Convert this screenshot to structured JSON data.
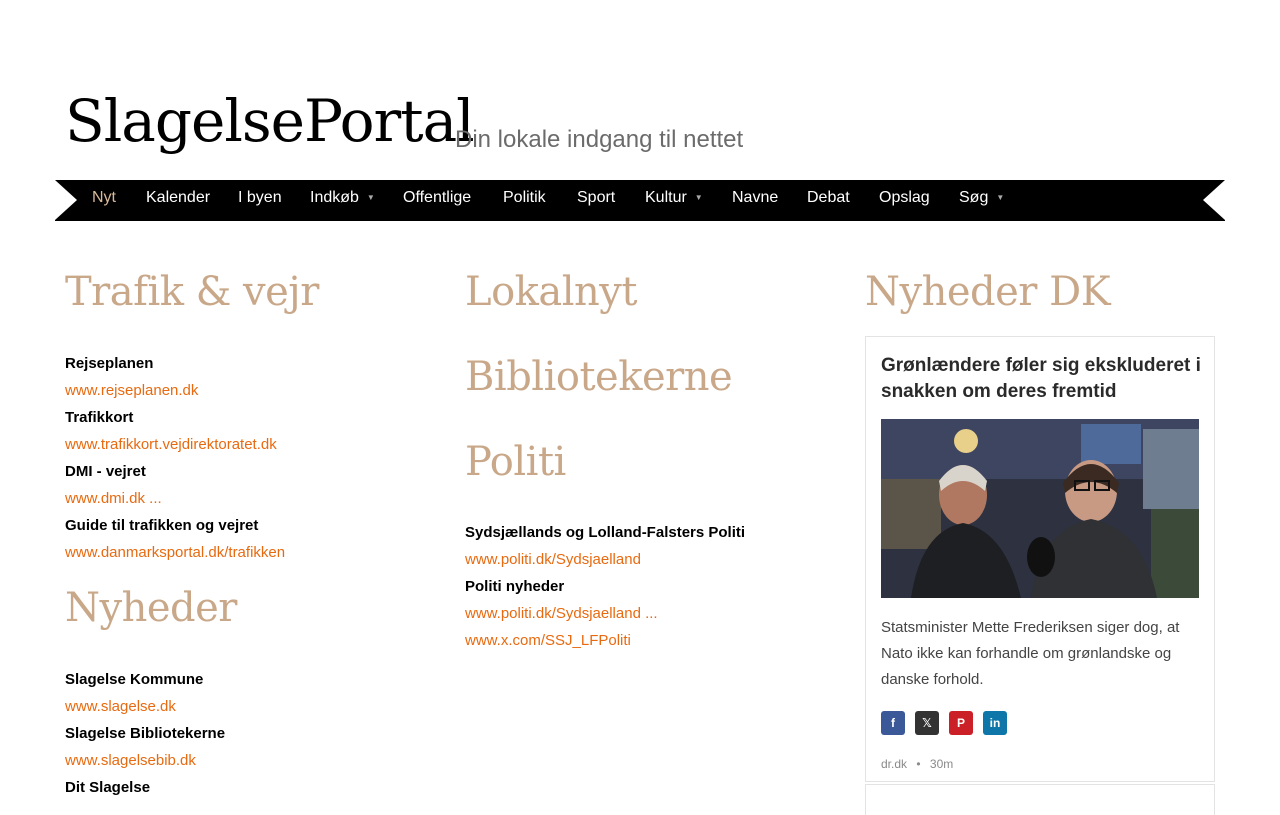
{
  "header": {
    "title": "SlagelsePortal",
    "tagline": "Din lokale indgang til nettet"
  },
  "nav": {
    "items": [
      {
        "label": "Nyt",
        "active": true,
        "dropdown": false
      },
      {
        "label": "Kalender",
        "active": false,
        "dropdown": false
      },
      {
        "label": "I byen",
        "active": false,
        "dropdown": false
      },
      {
        "label": "Indkøb",
        "active": false,
        "dropdown": true
      },
      {
        "label": "Offentlige",
        "active": false,
        "dropdown": false
      },
      {
        "label": "Politik",
        "active": false,
        "dropdown": false
      },
      {
        "label": "Sport",
        "active": false,
        "dropdown": false
      },
      {
        "label": "Kultur",
        "active": false,
        "dropdown": true
      },
      {
        "label": "Navne",
        "active": false,
        "dropdown": false
      },
      {
        "label": "Debat",
        "active": false,
        "dropdown": false
      },
      {
        "label": "Opslag",
        "active": false,
        "dropdown": false
      },
      {
        "label": "Søg",
        "active": false,
        "dropdown": true
      }
    ],
    "caret": "▼"
  },
  "col1": {
    "heading1": "Trafik & vejr",
    "links1": [
      {
        "label": "Rejseplanen",
        "url": "www.rejseplanen.dk"
      },
      {
        "label": "Trafikkort",
        "url": "www.trafikkort.vejdirektoratet.dk"
      },
      {
        "label": "DMI - vejret",
        "url": "www.dmi.dk ..."
      },
      {
        "label": "Guide til trafikken og vejret",
        "url": "www.danmarksportal.dk/trafikken"
      }
    ],
    "heading2": "Nyheder",
    "links2": [
      {
        "label": "Slagelse Kommune",
        "url": "www.slagelse.dk"
      },
      {
        "label": "Slagelse Bibliotekerne",
        "url": "www.slagelsebib.dk"
      },
      {
        "label": "Dit Slagelse"
      }
    ]
  },
  "col2": {
    "heading1": "Lokalnyt",
    "heading2": "Bibliotekerne",
    "heading3": "Politi",
    "links": [
      {
        "label": "Sydsjællands og Lolland-Falsters Politi",
        "url": "www.politi.dk/Sydsjaelland"
      },
      {
        "label": "Politi nyheder",
        "url": "www.politi.dk/Sydsjaelland ...",
        "url2": "www.x.com/SSJ_LFPoliti"
      }
    ]
  },
  "col3": {
    "heading": "Nyheder DK",
    "card": {
      "title": "Grønlændere føler sig ekskluderet i snakken om deres fremtid",
      "summary": "Statsminister Mette Frederiksen siger dog, at Nato ikke kan forhandle om grønlandske og danske forhold.",
      "source": "dr.dk",
      "separator": "•",
      "age": "30m"
    },
    "share": [
      {
        "name": "facebook-icon",
        "glyph": "f",
        "color": "#3b5998"
      },
      {
        "name": "x-icon",
        "glyph": "𝕏",
        "color": "#333333"
      },
      {
        "name": "pinterest-icon",
        "glyph": "P",
        "color": "#cb2027"
      },
      {
        "name": "linkedin-icon",
        "glyph": "in",
        "color": "#0e76a8"
      }
    ]
  },
  "colors": {
    "accent_link": "#e86a10",
    "heading": "#c9a88a",
    "nav_active": "#d9b99b"
  }
}
